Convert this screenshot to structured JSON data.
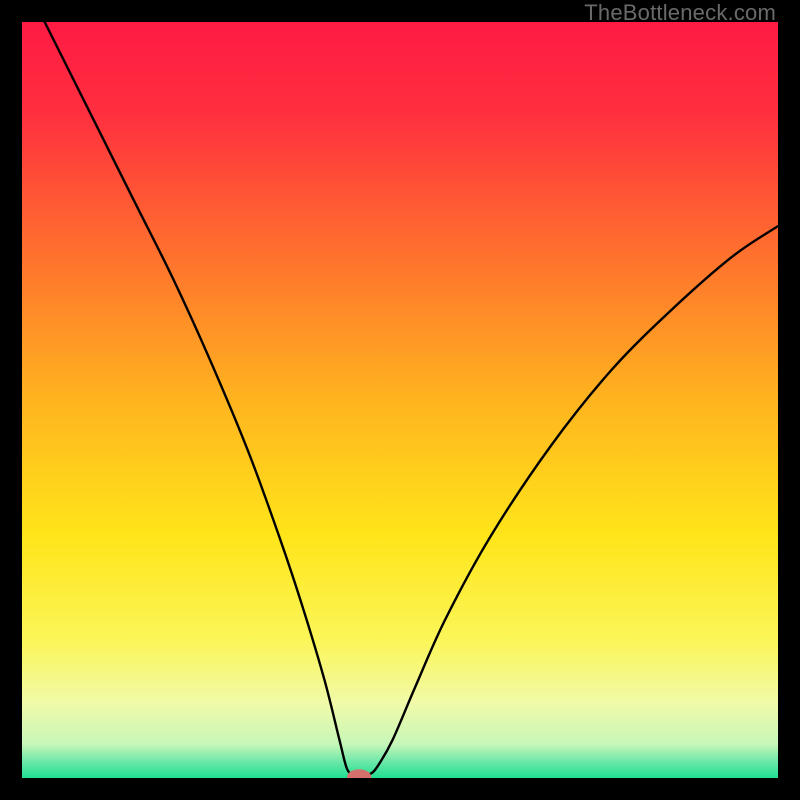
{
  "watermark": "TheBottleneck.com",
  "chart_data": {
    "type": "line",
    "title": "",
    "xlabel": "",
    "ylabel": "",
    "xlim": [
      0,
      100
    ],
    "ylim": [
      0,
      100
    ],
    "background_gradient": {
      "stops": [
        {
          "pos": 0.0,
          "color": "#ff1a44"
        },
        {
          "pos": 0.12,
          "color": "#ff2f3f"
        },
        {
          "pos": 0.3,
          "color": "#ff6e2e"
        },
        {
          "pos": 0.5,
          "color": "#ffb41f"
        },
        {
          "pos": 0.68,
          "color": "#ffe51a"
        },
        {
          "pos": 0.82,
          "color": "#fbf65a"
        },
        {
          "pos": 0.9,
          "color": "#f1faa8"
        },
        {
          "pos": 0.955,
          "color": "#c7f7b8"
        },
        {
          "pos": 0.98,
          "color": "#66e7a7"
        },
        {
          "pos": 1.0,
          "color": "#1fdf90"
        }
      ]
    },
    "series": [
      {
        "name": "bottleneck-curve",
        "stroke": "#000000",
        "stroke_width": 2.4,
        "points": [
          {
            "x": 3.0,
            "y": 100.0
          },
          {
            "x": 6.0,
            "y": 94.0
          },
          {
            "x": 10.0,
            "y": 86.0
          },
          {
            "x": 15.0,
            "y": 76.0
          },
          {
            "x": 20.0,
            "y": 66.0
          },
          {
            "x": 25.0,
            "y": 55.0
          },
          {
            "x": 30.0,
            "y": 43.0
          },
          {
            "x": 34.0,
            "y": 32.0
          },
          {
            "x": 37.0,
            "y": 23.0
          },
          {
            "x": 40.0,
            "y": 13.0
          },
          {
            "x": 42.0,
            "y": 5.0
          },
          {
            "x": 43.0,
            "y": 1.2
          },
          {
            "x": 44.0,
            "y": 0.4
          },
          {
            "x": 45.0,
            "y": 0.3
          },
          {
            "x": 46.0,
            "y": 0.5
          },
          {
            "x": 47.0,
            "y": 1.5
          },
          {
            "x": 49.0,
            "y": 5.0
          },
          {
            "x": 52.0,
            "y": 12.0
          },
          {
            "x": 56.0,
            "y": 21.0
          },
          {
            "x": 62.0,
            "y": 32.0
          },
          {
            "x": 70.0,
            "y": 44.0
          },
          {
            "x": 78.0,
            "y": 54.0
          },
          {
            "x": 86.0,
            "y": 62.0
          },
          {
            "x": 94.0,
            "y": 69.0
          },
          {
            "x": 100.0,
            "y": 73.0
          }
        ]
      }
    ],
    "marker": {
      "name": "optimal-point",
      "x": 44.6,
      "y": 0.15,
      "rx": 1.6,
      "ry": 1.0,
      "fill": "#d6706c"
    }
  }
}
